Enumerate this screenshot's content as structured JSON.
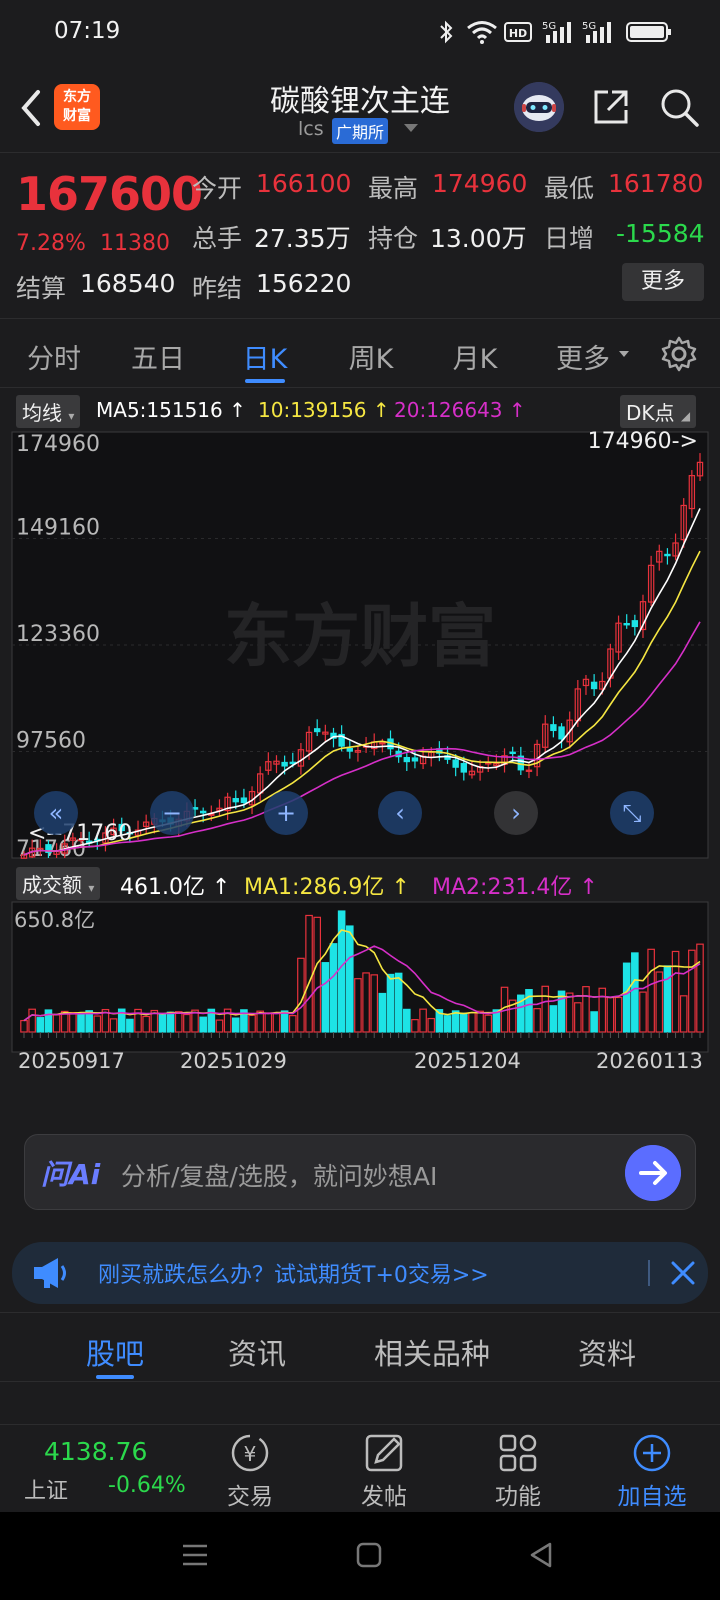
{
  "status_bar": {
    "time": "07:19",
    "icons": [
      "bluetooth-icon",
      "wifi-icon",
      "hd-icon",
      "signal-5g-icon",
      "signal-5g-icon",
      "battery-icon"
    ]
  },
  "header": {
    "logo_text_line1": "东方",
    "logo_text_line2": "财富",
    "title": "碳酸锂次主连",
    "code": "lcs",
    "exchange": "广期所"
  },
  "quote": {
    "price": "167600",
    "change_pct": "7.28%",
    "change_abs": "11380",
    "open_label": "今开",
    "open": "166100",
    "high_label": "最高",
    "high": "174960",
    "low_label": "最低",
    "low": "161780",
    "volume_label": "总手",
    "volume": "27.35万",
    "oi_label": "持仓",
    "oi": "13.00万",
    "daily_inc_label": "日增",
    "daily_inc": "-15584",
    "settle_label": "结算",
    "settle": "168540",
    "prev_settle_label": "昨结",
    "prev_settle": "156220",
    "more": "更多"
  },
  "period_tabs": [
    "分时",
    "五日",
    "日K",
    "周K",
    "月K",
    "更多"
  ],
  "active_tab": "日K",
  "ma_legend": {
    "selector": "均线",
    "ma5": "MA5:151516",
    "ma10": "10:139156",
    "ma20": "20:126643",
    "dk": "DK点"
  },
  "price_axis": {
    "labels": [
      "174960",
      "149160",
      "123360",
      "97560",
      "71760"
    ],
    "max_marker": "174960->",
    "min_marker": "<--71760"
  },
  "watermark": "东方财富",
  "volume_legend": {
    "selector": "成交额",
    "value": "461.0亿",
    "ma1": "MA1:286.9亿",
    "ma2": "MA2:231.4亿",
    "max_label": "650.8亿"
  },
  "date_axis": [
    "20250917",
    "20251029",
    "20251204",
    "20260113"
  ],
  "colors": {
    "up": "#e8323c",
    "down": "#1de3e6",
    "ma5": "#ffffff",
    "ma10": "#f5e642",
    "ma20": "#d62fc8",
    "accent": "#3f8cff"
  },
  "ai": {
    "logo": "问Ai",
    "placeholder": "分析/复盘/选股，就问妙想AI"
  },
  "notice": {
    "text": "刚买就跌怎么办？试试期货T+0交易>>"
  },
  "content_tabs": [
    "股吧",
    "资讯",
    "相关品种",
    "资料"
  ],
  "active_content_tab": "股吧",
  "bottom_nav": {
    "index_value": "4138.76",
    "index_name": "上证",
    "index_change": "-0.64%",
    "items": [
      "交易",
      "发帖",
      "功能",
      "加自选"
    ]
  }
}
